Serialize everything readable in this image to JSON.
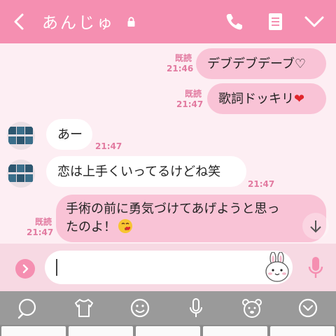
{
  "header": {
    "title": "あんじゅ",
    "background": "#f58fb1"
  },
  "messages": [
    {
      "direction": "out",
      "text": "デブデブデーブ♡",
      "read": "既読",
      "time": "21:46"
    },
    {
      "direction": "out",
      "text": "歌詞ドッキリ",
      "emoji": "❤",
      "read": "既読",
      "time": "21:47"
    },
    {
      "direction": "in",
      "text": "あー",
      "time": "21:47"
    },
    {
      "direction": "in",
      "text": "恋は上手くいってるけどね笑",
      "time": "21:47"
    },
    {
      "direction": "out",
      "text_line1": "手術の前に勇気づけてあげようと思っ",
      "text_line2": "たのよ！",
      "read": "既読",
      "time": "21:47"
    }
  ],
  "input": {
    "value": "",
    "placeholder": ""
  },
  "keyboard_toolbar": {
    "icons": [
      "search-icon",
      "tshirt-icon",
      "smiley-icon",
      "mic-icon",
      "bear-icon",
      "chevron-down-icon"
    ]
  },
  "colors": {
    "accent": "#f58fb1",
    "bubble_out": "#f9c3d6",
    "bubble_in": "#ffffff",
    "chat_bg": "#fdeef3",
    "meta": "#e27aa0"
  }
}
